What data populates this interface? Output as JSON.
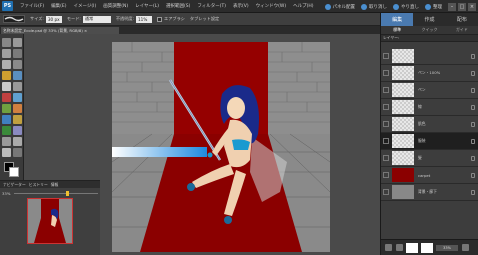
{
  "app": {
    "logo_text": "PS"
  },
  "menu": {
    "items": [
      "ファイル(F)",
      "編集(E)",
      "イメージ(I)",
      "画質調整(N)",
      "レイヤー(L)",
      "選択範囲(S)",
      "フィルター(T)",
      "表示(V)",
      "ウィンドウ(W)",
      "ヘルプ(H)"
    ]
  },
  "topright": {
    "share": "パネル配置",
    "undo": "取り消し",
    "redo": "やり直し",
    "organizer": "整理"
  },
  "options": {
    "size_label": "サイズ:",
    "size_value": "30 px",
    "mode_label": "モード:",
    "mode_value": "通常",
    "opacity_label": "不透明度:",
    "opacity_value": "11%",
    "airbrush_label": "エアブラシ",
    "tablet_label": "タブレット設定"
  },
  "document": {
    "tab_title": "名称未設定_Ecole.psd @ 33% (背景, RGB/8) ×"
  },
  "navigator": {
    "tabs": [
      "ナビゲーター",
      "ヒストリー",
      "情報"
    ],
    "zoom": "33%",
    "zoom_fraction": 0.62
  },
  "rpanel": {
    "mode_tabs": [
      "編集",
      "作成",
      "配布"
    ],
    "sub_tabs": [
      "標準",
      "クイック",
      "ガイド"
    ],
    "layers_label": "レイヤー:",
    "layers": [
      {
        "name": ""
      },
      {
        "name": "ペン・100%"
      },
      {
        "name": "ペン"
      },
      {
        "name": "線"
      },
      {
        "name": "肌色"
      },
      {
        "name": "服装"
      },
      {
        "name": "髪"
      },
      {
        "name": "carpet"
      },
      {
        "name": "背景・廊下"
      }
    ],
    "selected_index": 5,
    "bottom_field": "33%"
  },
  "colors": {
    "accent": "#4a7ab0",
    "carpet": "#8b0000",
    "hair": "#1a2a8a"
  }
}
